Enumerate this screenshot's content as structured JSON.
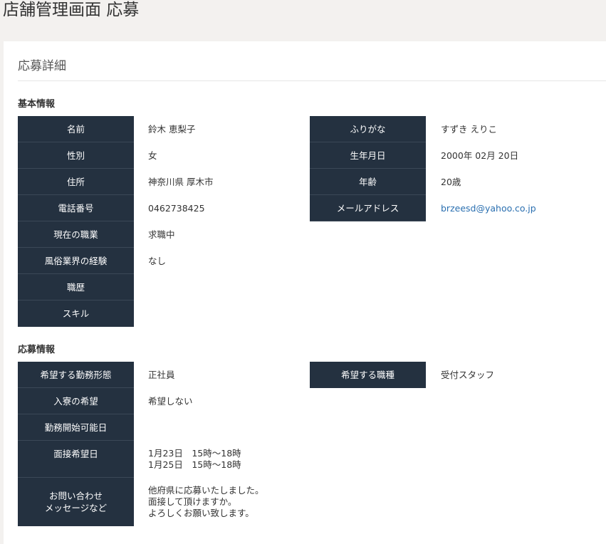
{
  "header": {
    "title": "店舗管理画面 応募"
  },
  "panel": {
    "title": "応募詳細"
  },
  "basic": {
    "section_title": "基本情報",
    "name_label": "名前",
    "name": "鈴木 恵梨子",
    "furigana_label": "ふりがな",
    "furigana": "すずき えりこ",
    "gender_label": "性別",
    "gender": "女",
    "birth_label": "生年月日",
    "birth": "2000年 02月 20日",
    "address_label": "住所",
    "address": "神奈川県 厚木市",
    "age_label": "年齢",
    "age": "20歳",
    "phone_label": "電話番号",
    "phone": "0462738425",
    "email_label": "メールアドレス",
    "email": "brzeesd@yahoo.co.jp",
    "job_label": "現在の職業",
    "job": "求職中",
    "experience_label": "風俗業界の経験",
    "experience": "なし",
    "career_label": "職歴",
    "career": "",
    "skill_label": "スキル",
    "skill": ""
  },
  "application": {
    "section_title": "応募情報",
    "employment_label": "希望する勤務形態",
    "employment": "正社員",
    "jobtype_label": "希望する職種",
    "jobtype": "受付スタッフ",
    "dorm_label": "入寮の希望",
    "dorm": "希望しない",
    "start_label": "勤務開始可能日",
    "start": "",
    "interview_label": "面接希望日",
    "interview": "1月23日　15時～18時\n1月25日　15時～18時",
    "message_label": "お問い合わせ\nメッセージなど",
    "message": "他府県に応募いたしました。\n面接して頂けますか。\nよろしくお願い致します。"
  }
}
